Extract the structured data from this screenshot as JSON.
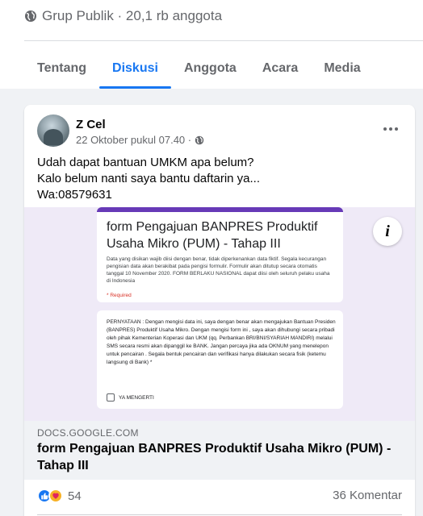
{
  "group": {
    "meta": "Grup Publik · 20,1 rb anggota"
  },
  "tabs": [
    {
      "label": "Tentang",
      "active": false
    },
    {
      "label": "Diskusi",
      "active": true
    },
    {
      "label": "Anggota",
      "active": false
    },
    {
      "label": "Acara",
      "active": false
    },
    {
      "label": "Media",
      "active": false
    }
  ],
  "post": {
    "author": "Z Cel",
    "timestamp": "22 Oktober pukul 07.40 ·",
    "text": "Udah dapat bantuan UMKM apa belum?\nKalo belum nanti saya bantu daftarin ya...\nWa:08579631",
    "preview": {
      "form_title": "form Pengajuan BANPRES Produktif Usaha Mikro (PUM) - Tahap III",
      "form_description": "Data yang disikan wajib diisi dengan benar, tidak diperkenankan data fiktif. Segala kecurangan pengisian data akan berakibat pada pengisi formulir. Formulir akan ditutup secara otomatis tanggal 10 November 2020. FORM BERLAKU NASIONAL dapat diisi oleh seluruh pelaku usaha di Indonesia",
      "required_note": "* Required",
      "statement": "PERNYATAAN : Dengan mengisi data ini, saya dengan benar akan mengajukan Bantuan Presiden (BANPRES) Produktif Usaha Mikro. Dengan mengisi form ini , saya akan dihubungi secara pribadi oleh pihak Kementerian Koperasi dan UKM (qq. Perbankan BRI/BNI/SYARIAH MANDIRI) melalui SMS secara resmi akan dipanggil ke BANK. Jangan percaya jika ada OKNUM yang menelepon untuk pencairan . Segala bentuk pencairan dan verifikasi hanya dilakukan secara fisik (ketemu langsung di Bank) *",
      "checkbox_label": "YA MENGERTI",
      "info_glyph": "i"
    },
    "link": {
      "domain": "DOCS.GOOGLE.COM",
      "title": "form Pengajuan BANPRES Produktif Usaha Mikro (PUM) - Tahap III"
    },
    "reactions": {
      "count": "54",
      "types": [
        "like-icon",
        "care-icon"
      ]
    },
    "comments": "36 Komentar"
  },
  "colors": {
    "accent": "#1877f2",
    "form_purple": "#673ab7",
    "muted_text": "#65676b"
  }
}
